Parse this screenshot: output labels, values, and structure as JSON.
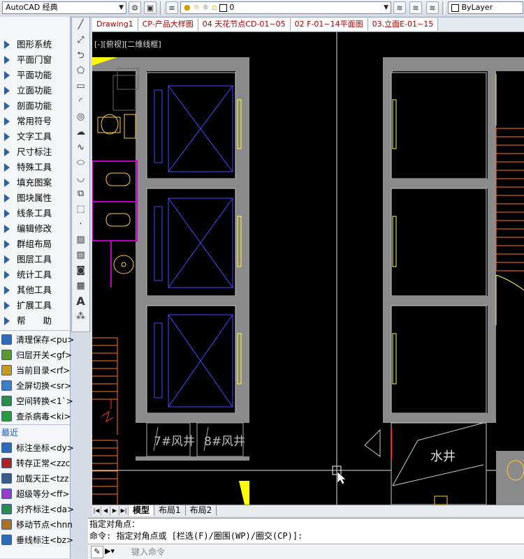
{
  "toolbar": {
    "workspace": "AutoCAD 经典",
    "layer": "0",
    "linetype": "ByLayer"
  },
  "left_menu": {
    "nav_items": [
      "图形系统",
      "平面门窗",
      "平面功能",
      "立面功能",
      "剖面功能",
      "常用符号",
      "文字工具",
      "尺寸标注",
      "特殊工具",
      "填充图案",
      "图块属性",
      "线条工具",
      "编辑修改",
      "群组布局",
      "图层工具",
      "统计工具",
      "其他工具",
      "扩展工具",
      "帮　　助"
    ],
    "commands": [
      "清理保存<pu>",
      "归层开关<gf>",
      "当前目录<rf>",
      "全屏切换<sr>",
      "空间转换<1`>",
      "查杀病毒<ki>"
    ],
    "recent_label": "最近",
    "recent_commands": [
      "标注坐标<dy>",
      "转存正常<zzc",
      "加载天正<tzz",
      "超级等分<ff>",
      "对齐标注<da>",
      "移动节点<hnn",
      "垂线标注<bz>"
    ]
  },
  "doc_tabs": [
    "Drawing1",
    "CP-产品大样图",
    "04 天花节点CD-01~05",
    "02 F-01~14平面图",
    "03.立面E-01~15"
  ],
  "viewport": {
    "label": "[-][俯视][二维线框]",
    "labels": {
      "vent7": "7#风井",
      "vent8": "8#风井",
      "water": "水井"
    }
  },
  "layout_tabs": [
    "模型",
    "布局1",
    "布局2"
  ],
  "command": {
    "history": [
      "指定对角点：",
      "命令: 指定对角点或 [栏选(F)/圈围(WP)/圈交(CP)]:"
    ],
    "input_placeholder": "键入命令"
  },
  "colors": {
    "canvas": "#000000",
    "wall": "#8a8a8a",
    "elevator": "#4646ff",
    "stair": "#ff7a1f",
    "door": "#ffff44",
    "toilet": "#ffcc33",
    "magenta": "#c000c0",
    "redline": "#ff2020"
  }
}
